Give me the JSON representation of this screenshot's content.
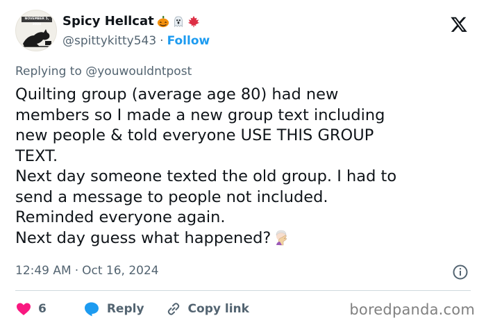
{
  "author": {
    "display_name": "Spicy Hellcat",
    "handle": "@spittykitty543",
    "separator": "·",
    "follow_label": "Follow",
    "avatar_banner_text": "NOVEMBER 5, 2024",
    "name_emojis": [
      "pumpkin-icon",
      "ghost-icon",
      "maple-leaf-icon"
    ]
  },
  "reply_context": {
    "prefix": "Replying to",
    "mention": "@youwouldntpost"
  },
  "tweet": {
    "lines": [
      "Quilting group (average age 80) had new",
      "members so I made a new group text including",
      "new people & told everyone USE THIS GROUP",
      "TEXT.",
      "Next day someone texted the old group. I had to",
      "send a message to people not included.",
      "Reminded everyone again.",
      "Next day guess what happened?"
    ],
    "trailing_emoji": "facepalm-icon",
    "time": "12:49 AM",
    "separator": "·",
    "date": "Oct 16, 2024"
  },
  "actions": {
    "like_count": "6",
    "reply_label": "Reply",
    "copy_label": "Copy link"
  },
  "watermark": "boredpanda.com",
  "colors": {
    "accent": "#1d9bf0",
    "like": "#f91880",
    "text": "#0f1419",
    "muted": "#536471",
    "divider": "#cfd9de"
  }
}
